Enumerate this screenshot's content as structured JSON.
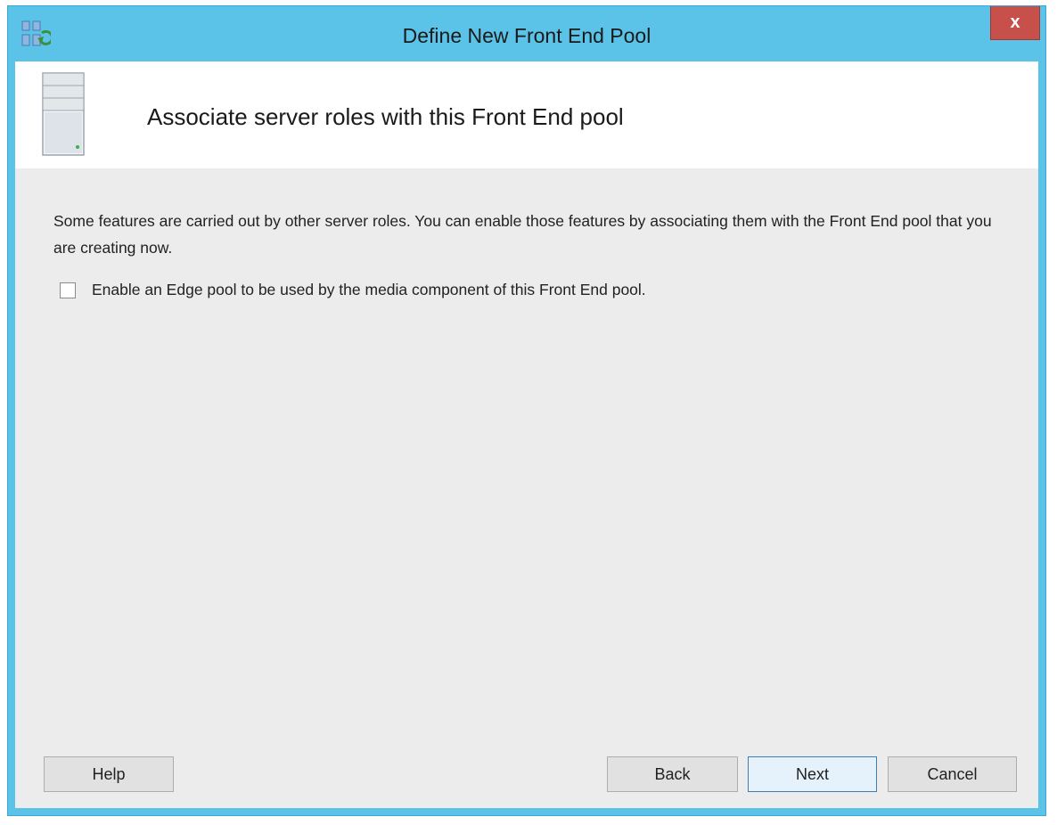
{
  "window": {
    "title": "Define New Front End Pool",
    "close_label": "x"
  },
  "header": {
    "title": "Associate server roles with this Front End pool"
  },
  "body": {
    "description": "Some features are carried out by other server roles. You can enable those features by associating them with the Front End pool that you are creating now.",
    "checkbox_label": "Enable an Edge pool to be used by the media component of this Front End pool.",
    "checkbox_checked": false
  },
  "buttons": {
    "help": "Help",
    "back": "Back",
    "next": "Next",
    "cancel": "Cancel"
  },
  "icons": {
    "app": "topology-builder-icon",
    "header": "server-icon"
  },
  "colors": {
    "title_bar": "#5bc3e8",
    "close_button": "#c7504a",
    "client_background": "#ececec",
    "next_border": "#3c7fb1"
  }
}
